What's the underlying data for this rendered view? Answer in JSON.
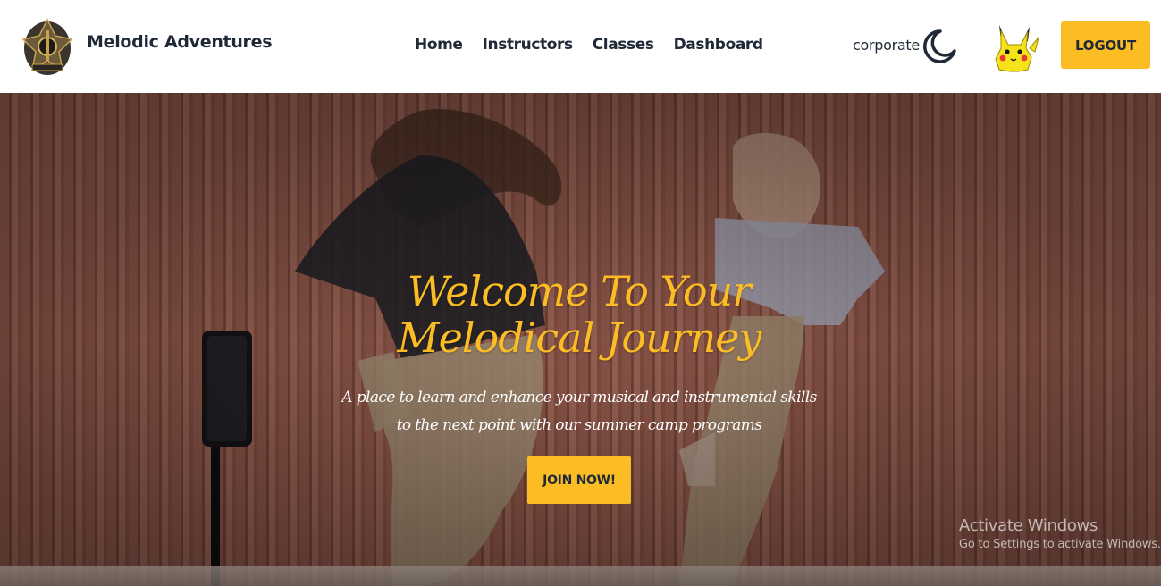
{
  "navbar": {
    "brand_name": "Melodic Adventures",
    "links": [
      {
        "label": "Home"
      },
      {
        "label": "Instructors"
      },
      {
        "label": "Classes"
      },
      {
        "label": "Dashboard"
      }
    ],
    "theme_label": "corporate",
    "theme_icon": "moon-icon",
    "logout_label": "LOGOUT"
  },
  "hero": {
    "title_line1": "Welcome To Your",
    "title_line2": "Melodical Journey",
    "subtitle_line1": "A place to learn and enhance your musical and instrumental skills",
    "subtitle_line2": "to the next point with our summer camp programs",
    "cta_label": "JOIN NOW!"
  },
  "watermark": {
    "title": "Activate Windows",
    "subtitle": "Go to Settings to activate Windows."
  },
  "colors": {
    "accent": "#fbbd23",
    "text_dark": "#1f2937",
    "hero_bg": "#b06b5c"
  }
}
